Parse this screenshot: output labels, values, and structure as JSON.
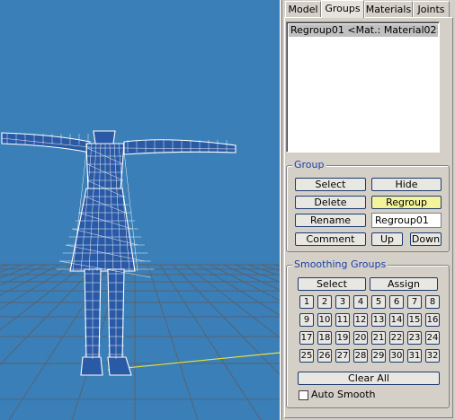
{
  "tabs": [
    "Model",
    "Groups",
    "Materials",
    "Joints"
  ],
  "active_tab": "Groups",
  "group_list": [
    "Regroup01 <Mat.: Material02>"
  ],
  "group": {
    "title": "Group",
    "select": "Select",
    "hide": "Hide",
    "delete": "Delete",
    "regroup": "Regroup",
    "rename": "Rename",
    "name_value": "Regroup01",
    "comment": "Comment",
    "up": "Up",
    "down": "Down"
  },
  "smoothing": {
    "title": "Smoothing Groups",
    "select": "Select",
    "assign": "Assign",
    "numbers": [
      "1",
      "2",
      "3",
      "4",
      "5",
      "6",
      "7",
      "8",
      "9",
      "10",
      "11",
      "12",
      "13",
      "14",
      "15",
      "16",
      "17",
      "18",
      "19",
      "20",
      "21",
      "22",
      "23",
      "24",
      "25",
      "26",
      "27",
      "28",
      "29",
      "30",
      "31",
      "32"
    ],
    "clear_all": "Clear All",
    "auto_smooth": "Auto Smooth"
  },
  "colors": {
    "viewport_bg": "#3a7fb8",
    "highlight_button": "#f4f39a",
    "group_title": "#1c3fa8"
  }
}
